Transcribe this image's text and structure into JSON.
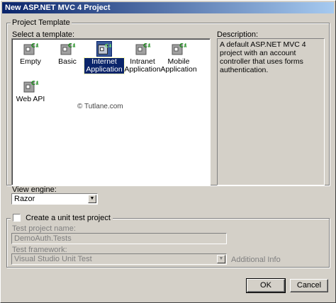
{
  "window": {
    "title": "New ASP.NET MVC 4 Project"
  },
  "project_template": {
    "group_label": "Project Template",
    "select_label": "Select a template:",
    "templates": [
      {
        "label": "Empty",
        "icon": "project-template-icon",
        "selected": false
      },
      {
        "label": "Basic",
        "icon": "project-template-icon",
        "selected": false
      },
      {
        "label": "Internet Application",
        "icon": "project-template-icon",
        "selected": true
      },
      {
        "label": "Intranet Application",
        "icon": "project-template-icon",
        "selected": false
      },
      {
        "label": "Mobile Application",
        "icon": "project-template-icon",
        "selected": false
      },
      {
        "label": "Web API",
        "icon": "project-template-icon",
        "selected": false
      }
    ],
    "watermark": "© Tutlane.com",
    "description_label": "Description:",
    "description_text": "A default ASP.NET MVC 4 project with an account controller that uses forms authentication.",
    "view_engine_label": "View engine:",
    "view_engine_value": "Razor"
  },
  "unit_test": {
    "checkbox_label": "Create a unit test project",
    "checked": false,
    "project_name_label": "Test project name:",
    "project_name_value": "DemoAuth.Tests",
    "framework_label": "Test framework:",
    "framework_value": "Visual Studio Unit Test",
    "additional_info": "Additional Info"
  },
  "buttons": {
    "ok": "OK",
    "cancel": "Cancel"
  },
  "colors": {
    "title_start": "#0a246a",
    "title_end": "#a6caf0",
    "selection": "#0a246a",
    "face": "#d4d0c8"
  }
}
